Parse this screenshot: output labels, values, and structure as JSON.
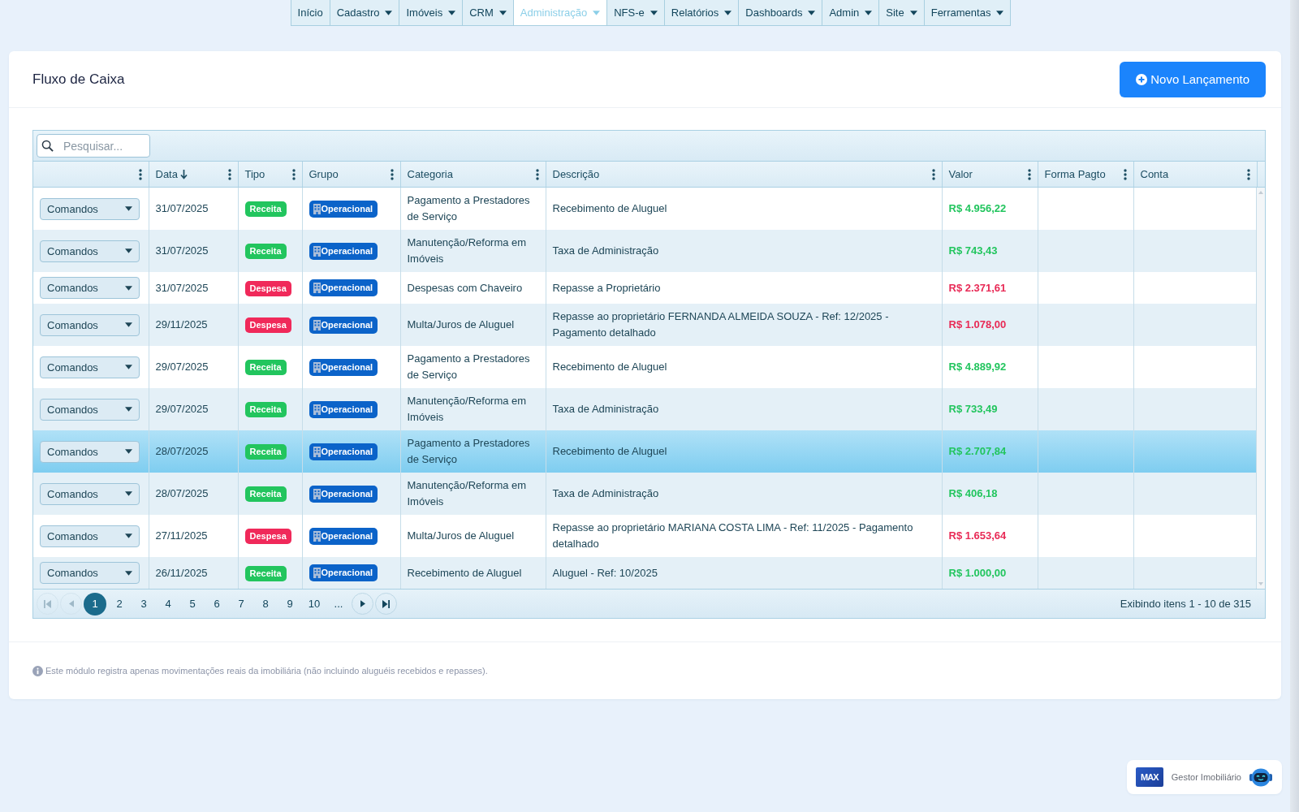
{
  "nav": {
    "items": [
      {
        "label": "Início",
        "has_menu": false,
        "selected": false
      },
      {
        "label": "Cadastro",
        "has_menu": true,
        "selected": false
      },
      {
        "label": "Imóveis",
        "has_menu": true,
        "selected": false
      },
      {
        "label": "CRM",
        "has_menu": true,
        "selected": false
      },
      {
        "label": "Administração",
        "has_menu": true,
        "selected": true
      },
      {
        "label": "NFS-e",
        "has_menu": true,
        "selected": false
      },
      {
        "label": "Relatórios",
        "has_menu": true,
        "selected": false
      },
      {
        "label": "Dashboards",
        "has_menu": true,
        "selected": false
      },
      {
        "label": "Admin",
        "has_menu": true,
        "selected": false
      },
      {
        "label": "Site",
        "has_menu": true,
        "selected": false
      },
      {
        "label": "Ferramentas",
        "has_menu": true,
        "selected": false
      }
    ]
  },
  "page": {
    "title": "Fluxo de Caixa",
    "new_button": "Novo Lançamento"
  },
  "table": {
    "search": {
      "placeholder": "Pesquisar..."
    },
    "columns": [
      {
        "sorted": false
      },
      {
        "label": "Data",
        "sorted": true
      },
      {
        "label": "Tipo",
        "sorted": false
      },
      {
        "label": "Grupo",
        "sorted": false
      },
      {
        "label": "Categoria",
        "sorted": false
      },
      {
        "label": "Descrição",
        "sorted": false
      },
      {
        "label": "Valor",
        "sorted": false
      },
      {
        "label": "Forma Pagto",
        "sorted": false
      },
      {
        "label": "Conta",
        "sorted": false
      }
    ],
    "rows": [
      {
        "command": "Comandos",
        "date": "31/07/2025",
        "type": {
          "kind": "income",
          "label": "Receita"
        },
        "group": "Operacional",
        "category": "Pagamento a Prestadores de Serviço",
        "description": "Recebimento de Aluguel",
        "value": "R$ 4.956,22",
        "selected": false
      },
      {
        "command": "Comandos",
        "date": "31/07/2025",
        "type": {
          "kind": "income",
          "label": "Receita"
        },
        "group": "Operacional",
        "category": "Manutenção/Reforma em Imóveis",
        "description": "Taxa de Administração",
        "value": "R$ 743,43",
        "selected": false
      },
      {
        "command": "Comandos",
        "date": "31/07/2025",
        "type": {
          "kind": "expense",
          "label": "Despesa"
        },
        "group": "Operacional",
        "category": "Despesas com Chaveiro",
        "description": "Repasse a Proprietário",
        "value": "R$ 2.371,61",
        "selected": false
      },
      {
        "command": "Comandos",
        "date": "29/11/2025",
        "type": {
          "kind": "expense",
          "label": "Despesa"
        },
        "group": "Operacional",
        "category": "Multa/Juros de Aluguel",
        "description": "Repasse ao proprietário FERNANDA ALMEIDA SOUZA - Ref: 12/2025 - Pagamento detalhado",
        "value": "R$ 1.078,00",
        "selected": false
      },
      {
        "command": "Comandos",
        "date": "29/07/2025",
        "type": {
          "kind": "income",
          "label": "Receita"
        },
        "group": "Operacional",
        "category": "Pagamento a Prestadores de Serviço",
        "description": "Recebimento de Aluguel",
        "value": "R$ 4.889,92",
        "selected": false
      },
      {
        "command": "Comandos",
        "date": "29/07/2025",
        "type": {
          "kind": "income",
          "label": "Receita"
        },
        "group": "Operacional",
        "category": "Manutenção/Reforma em Imóveis",
        "description": "Taxa de Administração",
        "value": "R$ 733,49",
        "selected": false
      },
      {
        "command": "Comandos",
        "date": "28/07/2025",
        "type": {
          "kind": "income",
          "label": "Receita"
        },
        "group": "Operacional",
        "category": "Pagamento a Prestadores de Serviço",
        "description": "Recebimento de Aluguel",
        "value": "R$ 2.707,84",
        "selected": true
      },
      {
        "command": "Comandos",
        "date": "28/07/2025",
        "type": {
          "kind": "income",
          "label": "Receita"
        },
        "group": "Operacional",
        "category": "Manutenção/Reforma em Imóveis",
        "description": "Taxa de Administração",
        "value": "R$ 406,18",
        "selected": false
      },
      {
        "command": "Comandos",
        "date": "27/11/2025",
        "type": {
          "kind": "expense",
          "label": "Despesa"
        },
        "group": "Operacional",
        "category": "Multa/Juros de Aluguel",
        "description": "Repasse ao proprietário MARIANA COSTA LIMA - Ref: 11/2025 - Pagamento detalhado",
        "value": "R$ 1.653,64",
        "selected": false
      },
      {
        "command": "Comandos",
        "date": "26/11/2025",
        "type": {
          "kind": "income",
          "label": "Receita"
        },
        "group": "Operacional",
        "category": "Recebimento de Aluguel",
        "description": "Aluguel - Ref: 10/2025",
        "value": "R$ 1.000,00",
        "selected": false
      }
    ],
    "pager": {
      "back": [
        {
          "kind": "first",
          "disabled": true
        },
        {
          "kind": "prev",
          "disabled": true
        }
      ],
      "pages": [
        {
          "label": "1",
          "selected": true
        },
        {
          "label": "2",
          "selected": false
        },
        {
          "label": "3",
          "selected": false
        },
        {
          "label": "4",
          "selected": false
        },
        {
          "label": "5",
          "selected": false
        },
        {
          "label": "6",
          "selected": false
        },
        {
          "label": "7",
          "selected": false
        },
        {
          "label": "8",
          "selected": false
        },
        {
          "label": "9",
          "selected": false
        },
        {
          "label": "10",
          "selected": false
        }
      ],
      "more": "...",
      "forward": [
        {
          "kind": "next",
          "disabled": false
        },
        {
          "kind": "last",
          "disabled": false
        }
      ],
      "summary": "Exibindo itens 1 - 10 de 315"
    }
  },
  "footer_note": "Este módulo registra apenas movimentações reais da imobiliária (não incluindo aluguéis recebidos e repasses).",
  "brand": {
    "logo": "MAX",
    "name": "Gestor Imobiliário"
  }
}
